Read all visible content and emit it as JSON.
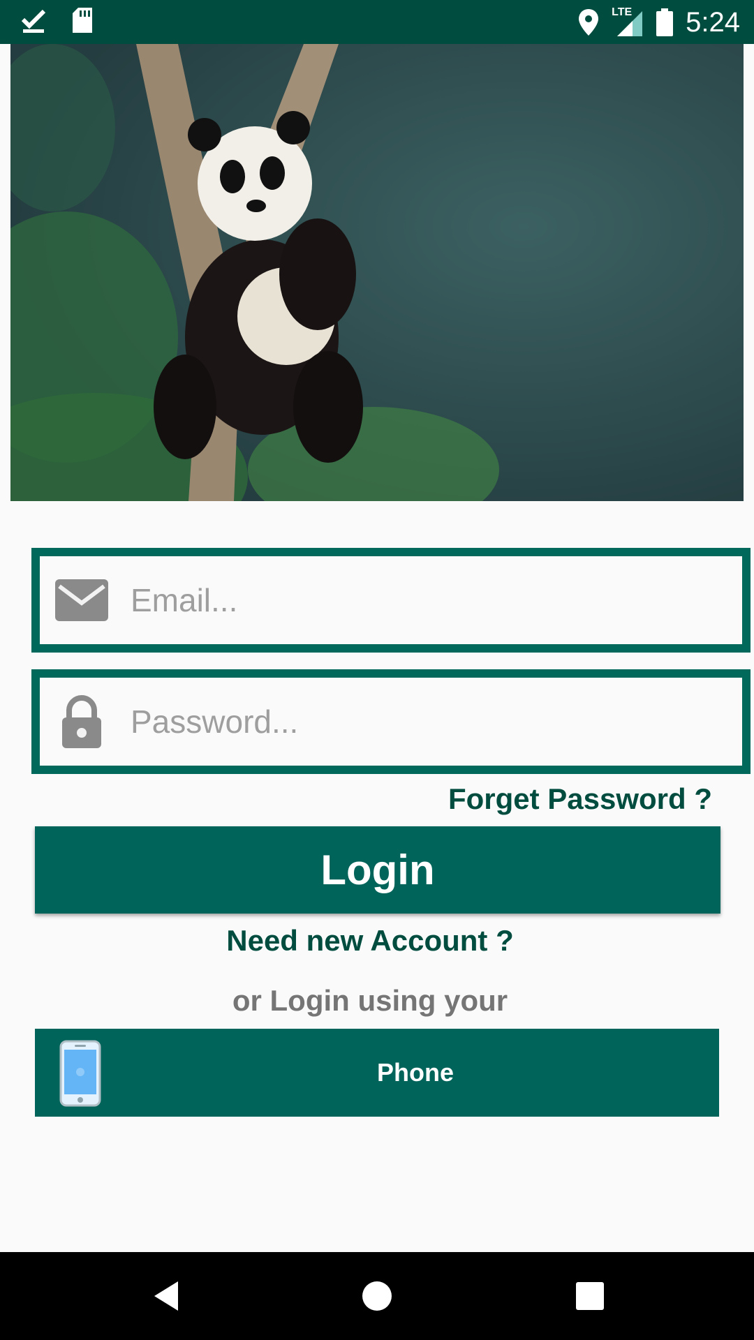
{
  "status_bar": {
    "time": "5:24",
    "network": "LTE",
    "icons": [
      "checkmark-icon",
      "sd-card-icon",
      "location-icon",
      "signal-icon",
      "battery-icon"
    ]
  },
  "hero": {
    "image": "panda-photo"
  },
  "form": {
    "email_placeholder": "Email...",
    "password_placeholder": "Password...",
    "forgot_label": "Forget Password ?",
    "login_label": "Login",
    "need_account_label": "Need new Account ?",
    "or_login_label": "or Login using your",
    "phone_label": "Phone"
  },
  "colors": {
    "primary": "#004d40",
    "accent": "#00645a",
    "placeholder": "#9e9e9e"
  }
}
